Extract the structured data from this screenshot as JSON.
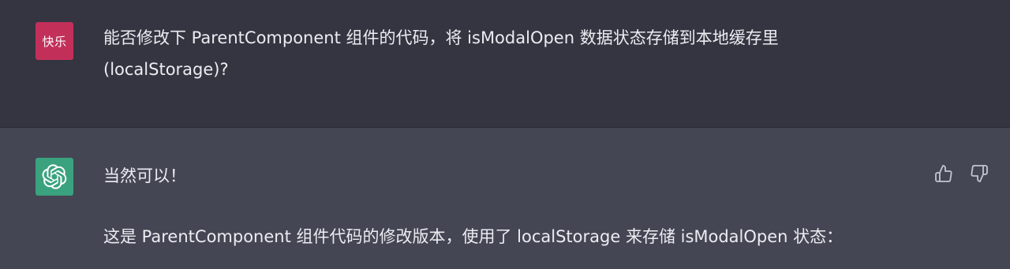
{
  "user_message": {
    "avatar_text": "快乐",
    "avatar_color": "#c2305a",
    "text": "能否修改下 ParentComponent 组件的代码，将 isModalOpen 数据状态存储到本地缓存里(localStorage)?"
  },
  "assistant_message": {
    "avatar_icon": "openai-logo-icon",
    "avatar_color": "#3aa27e",
    "line1": "当然可以！",
    "line2": "这是 ParentComponent 组件代码的修改版本，使用了 localStorage 来存储 isModalOpen 状态："
  },
  "feedback": {
    "up_icon": "thumbs-up-icon",
    "down_icon": "thumbs-down-icon"
  },
  "colors": {
    "user_bg": "#343541",
    "assistant_bg": "#444654",
    "text": "#ececf1"
  }
}
